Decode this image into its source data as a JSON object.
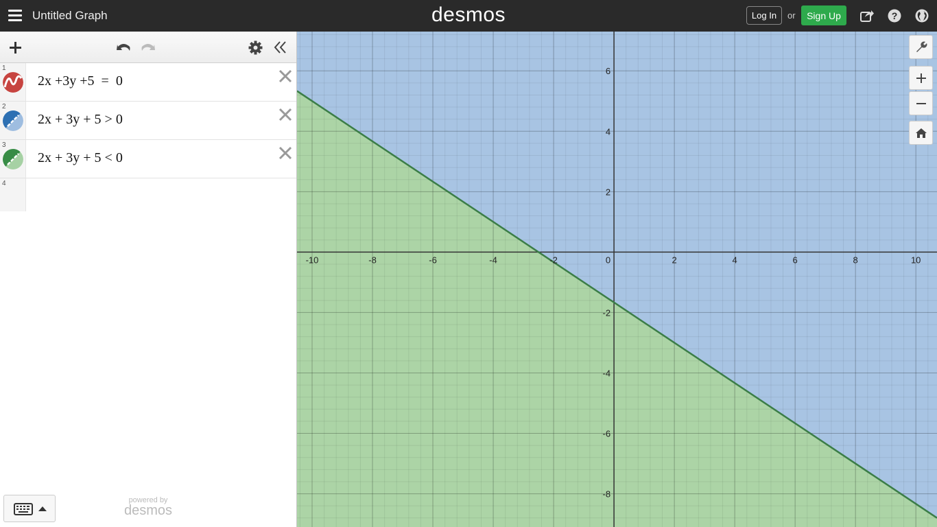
{
  "header": {
    "title": "Untitled Graph",
    "brand": "desmos",
    "login_label": "Log In",
    "or_text": "or",
    "signup_label": "Sign Up",
    "icons": [
      "share-icon",
      "help-icon",
      "globe-icon"
    ]
  },
  "toolbar": {
    "icons": [
      "add-icon",
      "undo-icon",
      "redo-icon",
      "settings-icon",
      "collapse-icon"
    ]
  },
  "expressions": [
    {
      "number": "1",
      "latex": "2x +3y +5  =  0",
      "color": "#c74440",
      "style": "graph"
    },
    {
      "number": "2",
      "latex": "2x + 3y + 5 > 0",
      "color": "#2d70b3",
      "style": "shaded"
    },
    {
      "number": "3",
      "latex": "2x + 3y + 5 < 0",
      "color": "#388c46",
      "style": "shaded"
    },
    {
      "number": "4",
      "latex": "",
      "color": "",
      "style": "empty"
    }
  ],
  "footer": {
    "powered_by": "powered by",
    "brand": "desmos"
  },
  "graph": {
    "x_ticks": [
      "-10",
      "-8",
      "-6",
      "-4",
      "-2",
      "0",
      "2",
      "4",
      "6",
      "8",
      "10"
    ],
    "y_ticks": [
      "6",
      "4",
      "2",
      "-2",
      "-4",
      "-6",
      "-8"
    ],
    "x_range": [
      -10.5,
      10.7
    ],
    "y_range": [
      -9.1,
      7.3
    ],
    "grid": true,
    "region_colors": {
      "above": "#a8c4e3",
      "below": "#acd4a6",
      "line": "#3b7d47"
    },
    "controls": [
      "wrench-icon",
      "zoom-in-icon",
      "zoom-out-icon",
      "home-icon"
    ]
  }
}
